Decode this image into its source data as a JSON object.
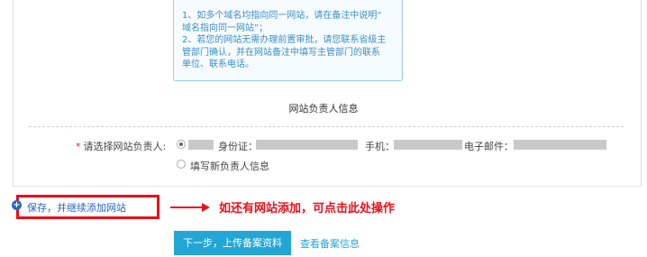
{
  "tip": {
    "lines": [
      "1、如多个域名均指向同一网站，请在备注中说明“",
      "域名指向同一网站”；",
      "2、若您的网站无需办理前置审批，请您联系省级主",
      "管部门确认，并在网站备注中填写主管部门的联系",
      "单位、联系电话。"
    ]
  },
  "section": {
    "title": "网站负责人信息"
  },
  "form": {
    "required_mark": "*",
    "label": "请选择网站负责人:",
    "id_label": "身份证：",
    "phone_label": "手机：",
    "email_label": "电子邮件：",
    "new_person_label": "填写新负责人信息"
  },
  "actions": {
    "save_label": "保存，并继续添加网站",
    "annotation": "如还有网站添加，可点击此处操作",
    "next_label": "下一步，上传备案资料",
    "view_label": "查看备案信息"
  }
}
